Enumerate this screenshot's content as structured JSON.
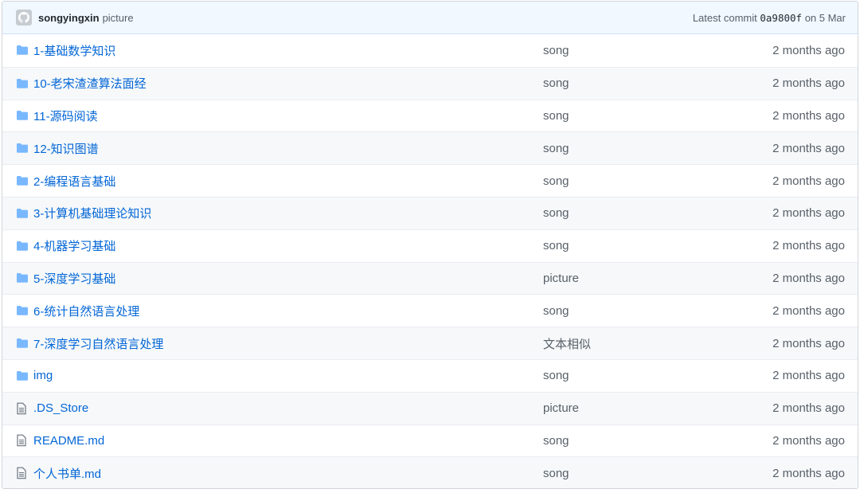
{
  "commit": {
    "author": "songyingxin",
    "message": "picture",
    "prefix": "Latest commit",
    "sha": "0a9800f",
    "date": "on 5 Mar"
  },
  "colors": {
    "link": "#0366d6",
    "folder_icon": "#79b8ff",
    "file_icon": "#6a737d"
  },
  "files": [
    {
      "type": "folder",
      "icon": "folder-icon",
      "name": "1-基础数学知识",
      "message": "song",
      "age": "2 months ago"
    },
    {
      "type": "folder",
      "icon": "folder-icon",
      "name": "10-老宋渣渣算法面经",
      "message": "song",
      "age": "2 months ago"
    },
    {
      "type": "folder",
      "icon": "folder-icon",
      "name": "11-源码阅读",
      "message": "song",
      "age": "2 months ago"
    },
    {
      "type": "folder",
      "icon": "folder-icon",
      "name": "12-知识图谱",
      "message": "song",
      "age": "2 months ago"
    },
    {
      "type": "folder",
      "icon": "folder-icon",
      "name": "2-编程语言基础",
      "message": "song",
      "age": "2 months ago"
    },
    {
      "type": "folder",
      "icon": "folder-icon",
      "name": "3-计算机基础理论知识",
      "message": "song",
      "age": "2 months ago"
    },
    {
      "type": "folder",
      "icon": "folder-icon",
      "name": "4-机器学习基础",
      "message": "song",
      "age": "2 months ago"
    },
    {
      "type": "folder",
      "icon": "folder-icon",
      "name": "5-深度学习基础",
      "message": "picture",
      "age": "2 months ago"
    },
    {
      "type": "folder",
      "icon": "folder-icon",
      "name": "6-统计自然语言处理",
      "message": "song",
      "age": "2 months ago"
    },
    {
      "type": "folder",
      "icon": "folder-icon",
      "name": "7-深度学习自然语言处理",
      "message": "文本相似",
      "age": "2 months ago"
    },
    {
      "type": "folder",
      "icon": "folder-icon",
      "name": "img",
      "message": "song",
      "age": "2 months ago"
    },
    {
      "type": "file",
      "icon": "file-icon",
      "name": ".DS_Store",
      "message": "picture",
      "age": "2 months ago"
    },
    {
      "type": "file",
      "icon": "file-icon",
      "name": "README.md",
      "message": "song",
      "age": "2 months ago"
    },
    {
      "type": "file",
      "icon": "file-icon",
      "name": "个人书单.md",
      "message": "song",
      "age": "2 months ago"
    }
  ]
}
